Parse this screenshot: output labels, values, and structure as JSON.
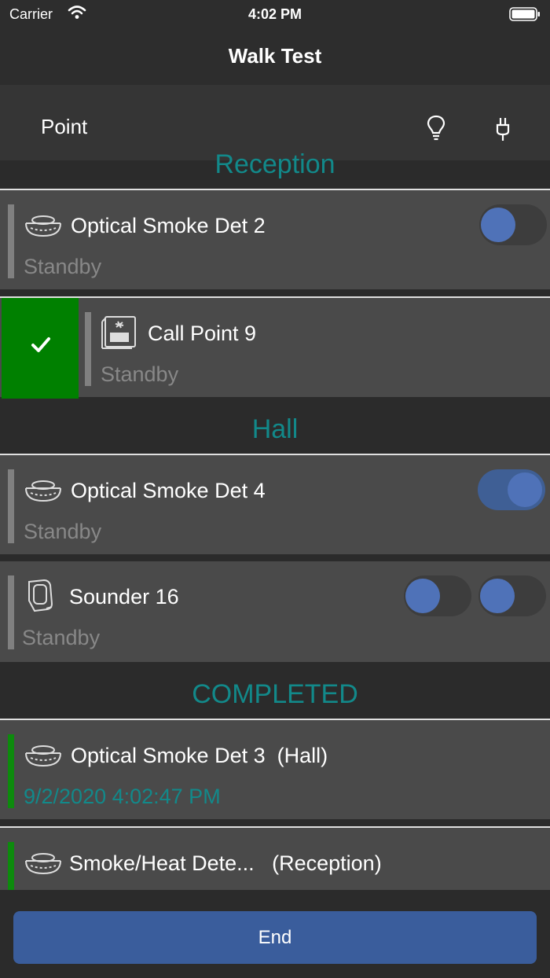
{
  "status_bar": {
    "carrier": "Carrier",
    "time": "4:02 PM"
  },
  "nav": {
    "title": "Walk Test"
  },
  "header": {
    "point_label": "Point",
    "bulb_icon": "lightbulb-icon",
    "plug_icon": "plug-icon"
  },
  "sections": [
    {
      "title": "Reception",
      "rows": [
        {
          "name": "Optical Smoke Det 2",
          "status": "Standby",
          "icon": "smoke-detector-icon",
          "toggles": [
            false
          ]
        },
        {
          "name": "Call Point 9",
          "status": "Standby",
          "icon": "call-point-icon",
          "swiped": true
        }
      ]
    },
    {
      "title": "Hall",
      "rows": [
        {
          "name": "Optical Smoke Det 4",
          "status": "Standby",
          "icon": "smoke-detector-icon",
          "toggles": [
            true
          ]
        },
        {
          "name": "Sounder 16",
          "status": "Standby",
          "icon": "sounder-icon",
          "toggles": [
            false,
            false
          ]
        }
      ]
    },
    {
      "title": "COMPLETED",
      "rows": [
        {
          "name": "Optical Smoke Det 3",
          "zone": "(Hall)",
          "timestamp": "9/2/2020 4:02:47 PM",
          "icon": "smoke-detector-icon"
        },
        {
          "name": "Smoke/Heat Dete...",
          "zone": "(Reception)",
          "icon": "smoke-detector-icon"
        }
      ]
    }
  ],
  "footer": {
    "end_label": "End"
  },
  "colors": {
    "accent_teal": "#12898a",
    "toggle_blue": "#4f72b8",
    "complete_green": "#0d8a0d",
    "end_button": "#3a5d9c"
  }
}
